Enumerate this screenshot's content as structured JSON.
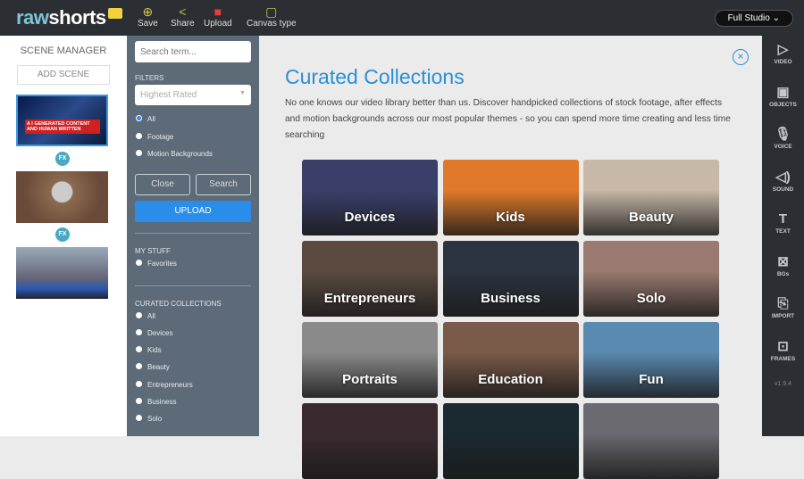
{
  "app": {
    "logo_a": "raw",
    "logo_b": "shorts"
  },
  "toolbar": {
    "save": "Save",
    "share": "Share",
    "upload": "Upload",
    "canvas": "Canvas type",
    "studio": "Full Studio"
  },
  "scene_manager": {
    "title": "SCENE MANAGER",
    "add": "ADD SCENE",
    "fx": "FX",
    "scene1_caption": "A I GENERATED CONTENT AND HUMAN WRITTEN"
  },
  "filters": {
    "search_placeholder": "Search term...",
    "filters_label": "FILTERS",
    "sort": "Highest Rated",
    "types": [
      "All",
      "Footage",
      "Motion Backgrounds"
    ],
    "close": "Close",
    "search": "Search",
    "upload": "UPLOAD",
    "my_stuff": "MY STUFF",
    "favorites": "Favorites",
    "curated_label": "CURATED COLLECTIONS",
    "curated": [
      "All",
      "Devices",
      "Kids",
      "Beauty",
      "Entrepreneurs",
      "Business",
      "Solo"
    ]
  },
  "main": {
    "title": "Curated Collections",
    "description": "No one knows our video library better than us. Discover handpicked collections of stock footage, after effects and motion backgrounds across our most popular themes - so you can spend more time creating and less time searching",
    "close": "×",
    "tiles": [
      {
        "label": "Devices",
        "color": "#3a3f6a"
      },
      {
        "label": "Kids",
        "color": "#e07a2a"
      },
      {
        "label": "Beauty",
        "color": "#c8b8a8"
      },
      {
        "label": "Entrepreneurs",
        "color": "#5a4a40"
      },
      {
        "label": "Business",
        "color": "#2c3340"
      },
      {
        "label": "Solo",
        "color": "#9a7a70"
      },
      {
        "label": "Portraits",
        "color": "#8a8a8a"
      },
      {
        "label": "Education",
        "color": "#7a5a48"
      },
      {
        "label": "Fun",
        "color": "#5a8ab0"
      },
      {
        "label": "",
        "color": "#3a2a30"
      },
      {
        "label": "",
        "color": "#1a2a30"
      },
      {
        "label": "",
        "color": "#6a6a70"
      }
    ]
  },
  "rightbar": {
    "items": [
      {
        "label": "VIDEO",
        "icon": "▷"
      },
      {
        "label": "OBJECTS",
        "icon": "▣"
      },
      {
        "label": "VOICE",
        "icon": "🎙"
      },
      {
        "label": "SOUND",
        "icon": "◁)"
      },
      {
        "label": "TEXT",
        "icon": "T"
      },
      {
        "label": "BGs",
        "icon": "⊠"
      },
      {
        "label": "IMPORT",
        "icon": "⎘"
      },
      {
        "label": "FRAMES",
        "icon": "⊡"
      }
    ],
    "version": "v1.9.4"
  }
}
